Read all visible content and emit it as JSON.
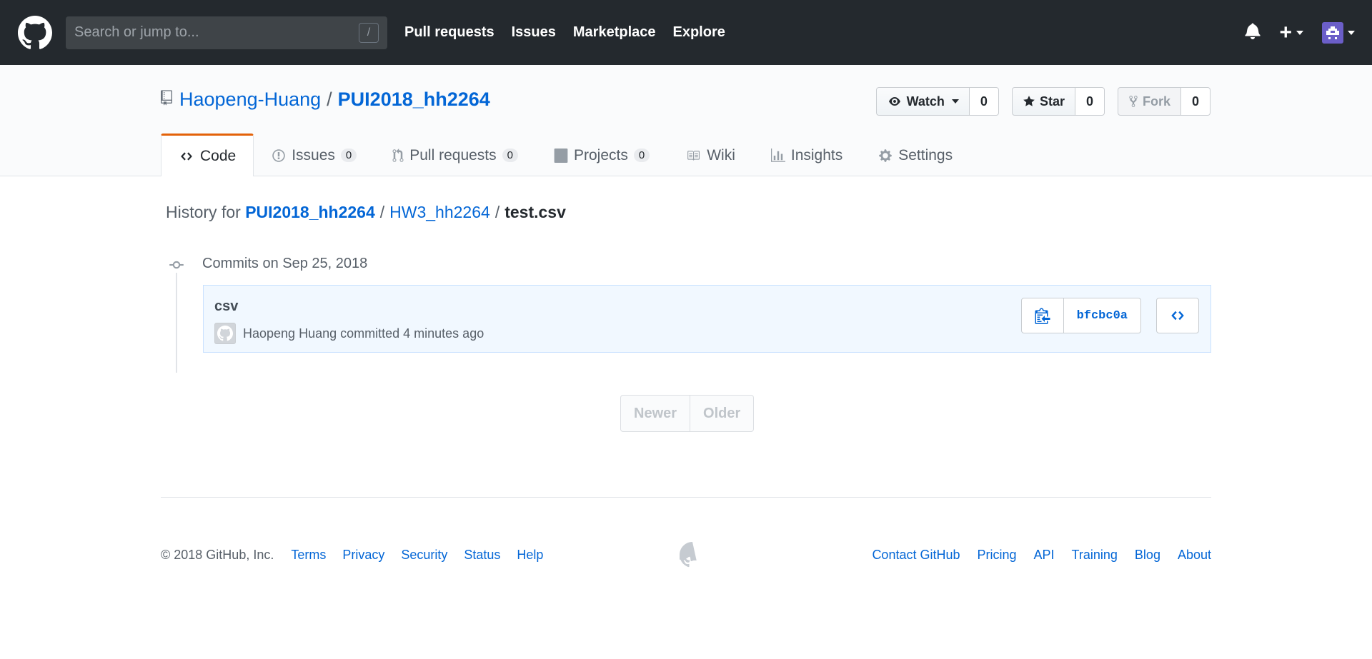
{
  "header": {
    "search_placeholder": "Search or jump to...",
    "search_shortcut": "/",
    "nav": [
      "Pull requests",
      "Issues",
      "Marketplace",
      "Explore"
    ],
    "plus_label": "+",
    "icons": [
      "github-logo-icon",
      "bell-icon",
      "plus-icon",
      "avatar-icon"
    ]
  },
  "repo": {
    "owner": "Haopeng-Huang",
    "separator": "/",
    "name": "PUI2018_hh2264",
    "watch_label": "Watch",
    "watch_count": "0",
    "star_label": "Star",
    "star_count": "0",
    "fork_label": "Fork",
    "fork_count": "0"
  },
  "tabs": [
    {
      "label": "Code",
      "icon": "code-icon"
    },
    {
      "label": "Issues",
      "counter": "0",
      "icon": "issue-icon"
    },
    {
      "label": "Pull requests",
      "counter": "0",
      "icon": "pull-request-icon"
    },
    {
      "label": "Projects",
      "counter": "0",
      "icon": "project-icon"
    },
    {
      "label": "Wiki",
      "icon": "book-icon"
    },
    {
      "label": "Insights",
      "icon": "graph-icon"
    },
    {
      "label": "Settings",
      "icon": "gear-icon"
    }
  ],
  "history": {
    "prefix": "History for",
    "repo": "PUI2018_hh2264",
    "folder": "HW3_hh2264",
    "file": "test.csv",
    "sep": "/"
  },
  "commits": {
    "date_heading": "Commits on Sep 25, 2018",
    "items": [
      {
        "message": "csv",
        "author": "Haopeng Huang",
        "meta": "committed 4 minutes ago",
        "sha": "bfcbc0a"
      }
    ]
  },
  "pagination": {
    "newer": "Newer",
    "older": "Older"
  },
  "footer": {
    "copyright": "© 2018 GitHub, Inc.",
    "left_links": [
      "Terms",
      "Privacy",
      "Security",
      "Status",
      "Help"
    ],
    "right_links": [
      "Contact GitHub",
      "Pricing",
      "API",
      "Training",
      "Blog",
      "About"
    ]
  }
}
